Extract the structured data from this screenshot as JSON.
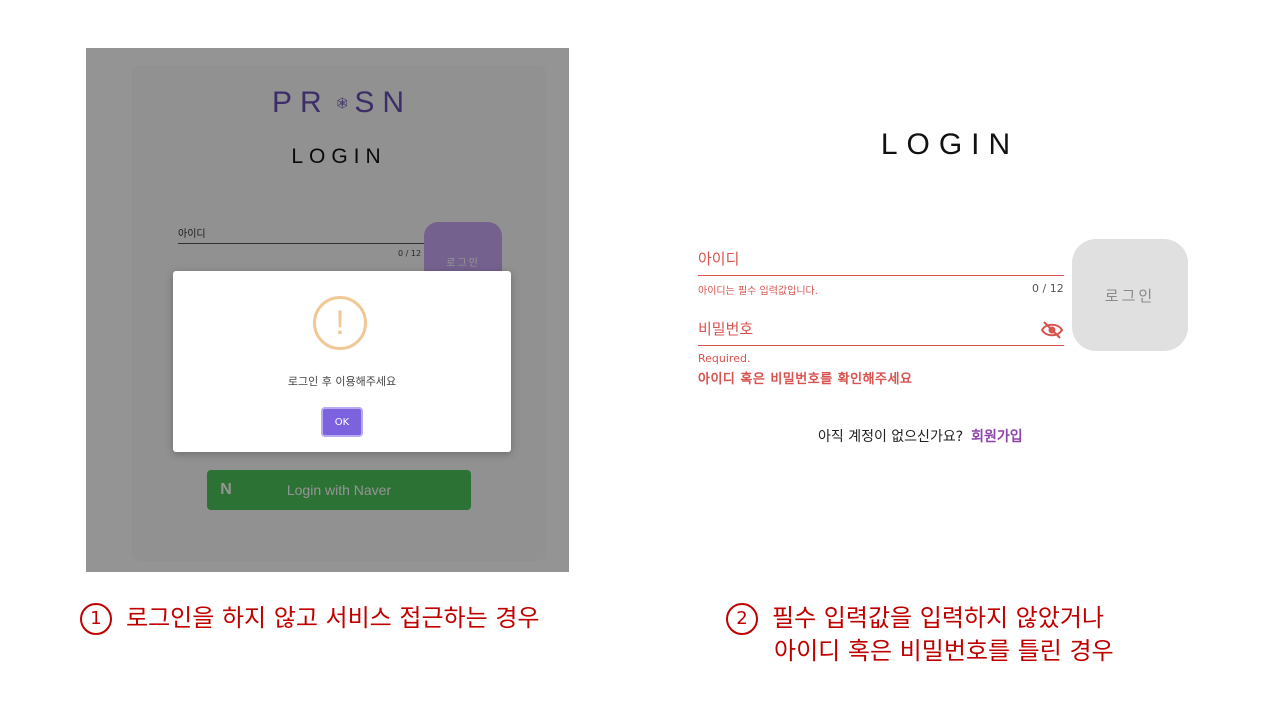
{
  "left_screen": {
    "logo_text": "PR SN",
    "title": "LOGIN",
    "id_field": {
      "placeholder": "아이디",
      "counter": "0 / 12"
    },
    "login_button": "로그인",
    "naver_button": {
      "icon": "N",
      "label": "Login with Naver"
    },
    "dialog": {
      "icon": "!",
      "message": "로그인 후 이용해주세요",
      "ok_label": "OK"
    }
  },
  "right_screen": {
    "title": "LOGIN",
    "id_field": {
      "placeholder": "아이디",
      "error": "아이디는 필수 입력값입니다.",
      "counter": "0 / 12"
    },
    "password_field": {
      "placeholder": "비밀번호",
      "error": "Required."
    },
    "auth_error": "아이디 혹은 비밀번호를 확인해주세요",
    "login_button": "로그인",
    "signup_prompt": "아직 계정이 없으신가요?",
    "signup_link": "회원가입"
  },
  "captions": {
    "case1": {
      "num": "1",
      "text": "로그인을 하지 않고 서비스 접근하는 경우"
    },
    "case2": {
      "num": "2",
      "line1": "필수 입력값을 입력하지 않았거나",
      "line2": "아이디 혹은 비밀번호를 틀린 경우"
    }
  },
  "colors": {
    "accent_purple": "#7d62e0",
    "error_red": "#d9534f",
    "caption_red": "#c00000"
  }
}
